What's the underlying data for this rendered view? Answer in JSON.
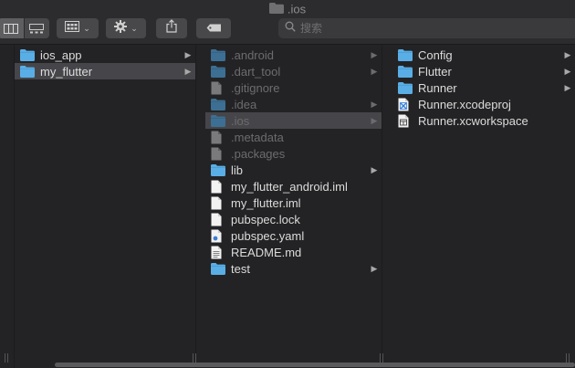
{
  "window": {
    "title": ".ios"
  },
  "toolbar": {
    "view_icons": [
      "columns-view-icon",
      "gallery-view-icon"
    ],
    "group_icon": "grid-group-icon",
    "action_icon": "gear-icon",
    "share_icon": "share-icon",
    "tag_icon": "tag-icon"
  },
  "search": {
    "placeholder": "搜索",
    "value": ""
  },
  "colors": {
    "folder": "#5aaee6",
    "selected_row": "#46464a",
    "background": "#232325"
  },
  "columns": [
    {
      "items": [
        {
          "label": "ios_app",
          "type": "folder",
          "hasArrow": true,
          "selected": false,
          "dim": false
        },
        {
          "label": "my_flutter",
          "type": "folder",
          "hasArrow": true,
          "selected": true,
          "dim": false
        }
      ]
    },
    {
      "items": [
        {
          "label": ".android",
          "type": "folder",
          "hasArrow": true,
          "selected": false,
          "dim": true
        },
        {
          "label": ".dart_tool",
          "type": "folder",
          "hasArrow": true,
          "selected": false,
          "dim": true
        },
        {
          "label": ".gitignore",
          "type": "file",
          "hasArrow": false,
          "selected": false,
          "dim": true
        },
        {
          "label": ".idea",
          "type": "folder",
          "hasArrow": true,
          "selected": false,
          "dim": true
        },
        {
          "label": ".ios",
          "type": "folder",
          "hasArrow": true,
          "selected": true,
          "dim": true
        },
        {
          "label": ".metadata",
          "type": "file",
          "hasArrow": false,
          "selected": false,
          "dim": true
        },
        {
          "label": ".packages",
          "type": "file",
          "hasArrow": false,
          "selected": false,
          "dim": true
        },
        {
          "label": "lib",
          "type": "folder",
          "hasArrow": true,
          "selected": false,
          "dim": false
        },
        {
          "label": "my_flutter_android.iml",
          "type": "file",
          "hasArrow": false,
          "selected": false,
          "dim": false
        },
        {
          "label": "my_flutter.iml",
          "type": "file",
          "hasArrow": false,
          "selected": false,
          "dim": false
        },
        {
          "label": "pubspec.lock",
          "type": "file",
          "hasArrow": false,
          "selected": false,
          "dim": false
        },
        {
          "label": "pubspec.yaml",
          "type": "yaml",
          "hasArrow": false,
          "selected": false,
          "dim": false
        },
        {
          "label": "README.md",
          "type": "text",
          "hasArrow": false,
          "selected": false,
          "dim": false
        },
        {
          "label": "test",
          "type": "folder",
          "hasArrow": true,
          "selected": false,
          "dim": false
        }
      ]
    },
    {
      "items": [
        {
          "label": "Config",
          "type": "folder",
          "hasArrow": true,
          "selected": false,
          "dim": false
        },
        {
          "label": "Flutter",
          "type": "folder",
          "hasArrow": true,
          "selected": false,
          "dim": false
        },
        {
          "label": "Runner",
          "type": "folder",
          "hasArrow": true,
          "selected": false,
          "dim": false
        },
        {
          "label": "Runner.xcodeproj",
          "type": "xcodeproj",
          "hasArrow": false,
          "selected": false,
          "dim": false
        },
        {
          "label": "Runner.xcworkspace",
          "type": "xcworkspace",
          "hasArrow": false,
          "selected": false,
          "dim": false
        }
      ]
    }
  ]
}
